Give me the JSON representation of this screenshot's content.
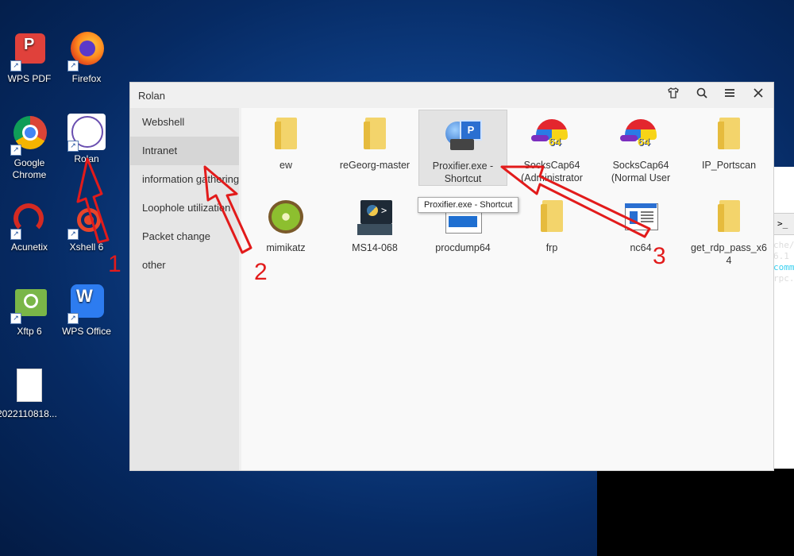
{
  "desktop": {
    "icons": [
      {
        "label": "WPS PDF"
      },
      {
        "label": "Firefox"
      },
      {
        "label": "Google Chrome"
      },
      {
        "label": "Rolan"
      },
      {
        "label": "Acunetix"
      },
      {
        "label": "Xshell 6"
      },
      {
        "label": "Xftp 6"
      },
      {
        "label": "WPS Office"
      },
      {
        "label": "2022110818..."
      }
    ]
  },
  "terminal": {
    "tab_label": ">_ 1",
    "lines": [
      "che/",
      "",
      "6.1",
      "",
      "comm",
      "rpc."
    ]
  },
  "window": {
    "title": "Rolan",
    "icons": [
      "shirt-icon",
      "search-icon",
      "menu-icon",
      "close-icon"
    ]
  },
  "sidebar": {
    "items": [
      {
        "label": "Webshell"
      },
      {
        "label": "Intranet"
      },
      {
        "label": "information gathering"
      },
      {
        "label": "Loophole utilization"
      },
      {
        "label": "Packet change"
      },
      {
        "label": "other"
      }
    ],
    "active": "Intranet"
  },
  "tiles": [
    {
      "label": "ew"
    },
    {
      "label": "reGeorg-master"
    },
    {
      "label": "Proxifier.exe - Shortcut"
    },
    {
      "label": "SocksCap64 (Administrator"
    },
    {
      "label": "SocksCap64 (Normal User"
    },
    {
      "label": "IP_Portscan"
    },
    {
      "label": "mimikatz"
    },
    {
      "label": "MS14-068"
    },
    {
      "label": "procdump64"
    },
    {
      "label": "frp"
    },
    {
      "label": "nc64"
    },
    {
      "label": "get_rdp_pass_x64"
    }
  ],
  "tooltip": "Proxifier.exe - Shortcut",
  "annotations": [
    "1",
    "2",
    "3"
  ],
  "colors": {
    "annotation": "#e21b1b",
    "folder": "#f3d46b"
  }
}
